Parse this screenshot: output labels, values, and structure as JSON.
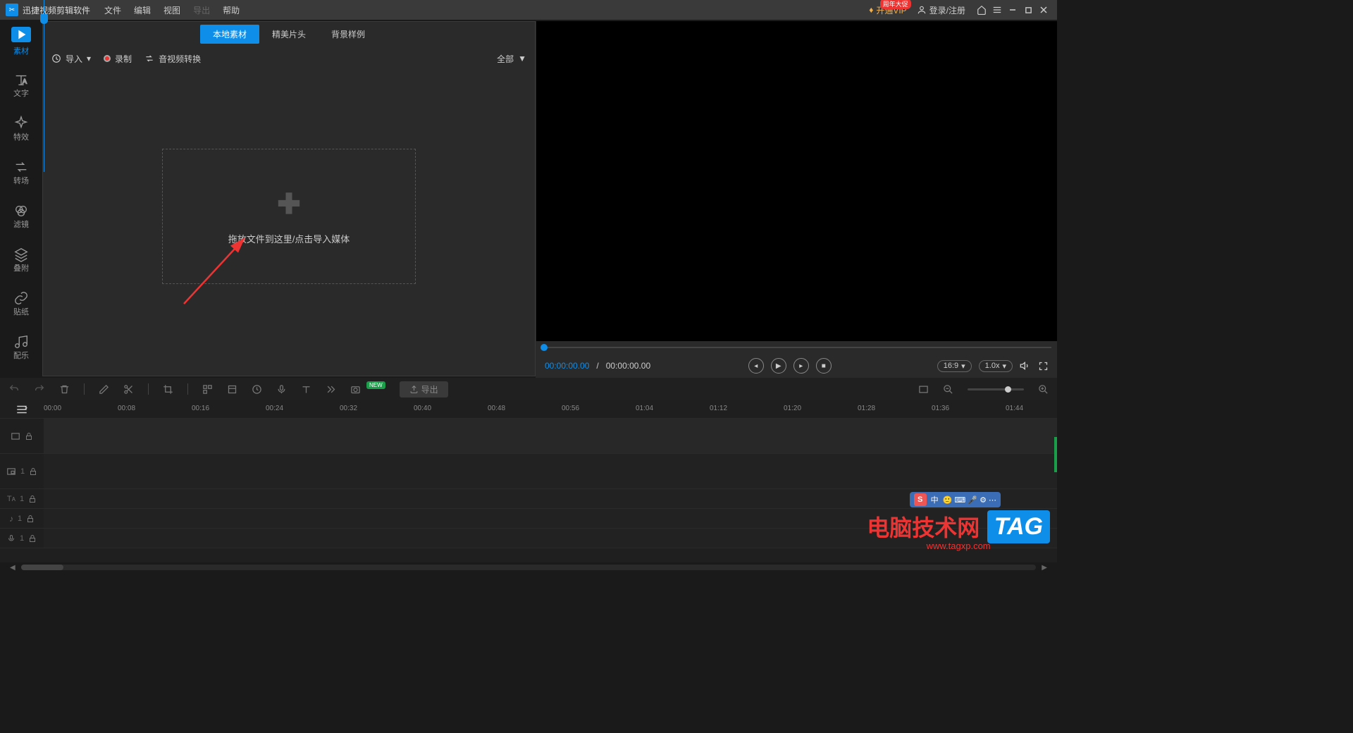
{
  "titlebar": {
    "app_title": "迅捷视频剪辑软件",
    "menus": [
      "文件",
      "编辑",
      "视图",
      "导出",
      "帮助"
    ],
    "vip_label": "开通VIP",
    "vip_badge": "周年大促",
    "login_label": "登录/注册"
  },
  "sidebar": {
    "items": [
      {
        "label": "素材"
      },
      {
        "label": "文字"
      },
      {
        "label": "特效"
      },
      {
        "label": "转场"
      },
      {
        "label": "滤镜"
      },
      {
        "label": "叠附"
      },
      {
        "label": "贴纸"
      },
      {
        "label": "配乐"
      }
    ]
  },
  "media": {
    "tabs": [
      "本地素材",
      "精美片头",
      "背景样例"
    ],
    "toolbar": {
      "import_label": "导入",
      "record_label": "录制",
      "convert_label": "音视频转换",
      "filter_label": "全部"
    },
    "drop_text": "拖放文件到这里/点击导入媒体"
  },
  "preview": {
    "time_current": "00:00:00.00",
    "time_total": "00:00:00.00",
    "aspect": "16:9",
    "speed": "1.0x"
  },
  "toolbar2": {
    "export_label": "导出",
    "new_badge": "NEW"
  },
  "timeline": {
    "marks": [
      "00:00",
      "00:08",
      "00:16",
      "00:24",
      "00:32",
      "00:40",
      "00:48",
      "00:56",
      "01:04",
      "01:12",
      "01:20",
      "01:28",
      "01:36",
      "01:44"
    ],
    "tracks": [
      {
        "icon": "video",
        "num": ""
      },
      {
        "icon": "pip",
        "num": "1"
      },
      {
        "icon": "text",
        "num": "1"
      },
      {
        "icon": "music",
        "num": "1"
      },
      {
        "icon": "mic",
        "num": "1"
      }
    ]
  },
  "watermark": {
    "text": "电脑技术网",
    "url": "www.tagxp.com",
    "tag": "TAG"
  },
  "ime": {
    "label": "中"
  }
}
